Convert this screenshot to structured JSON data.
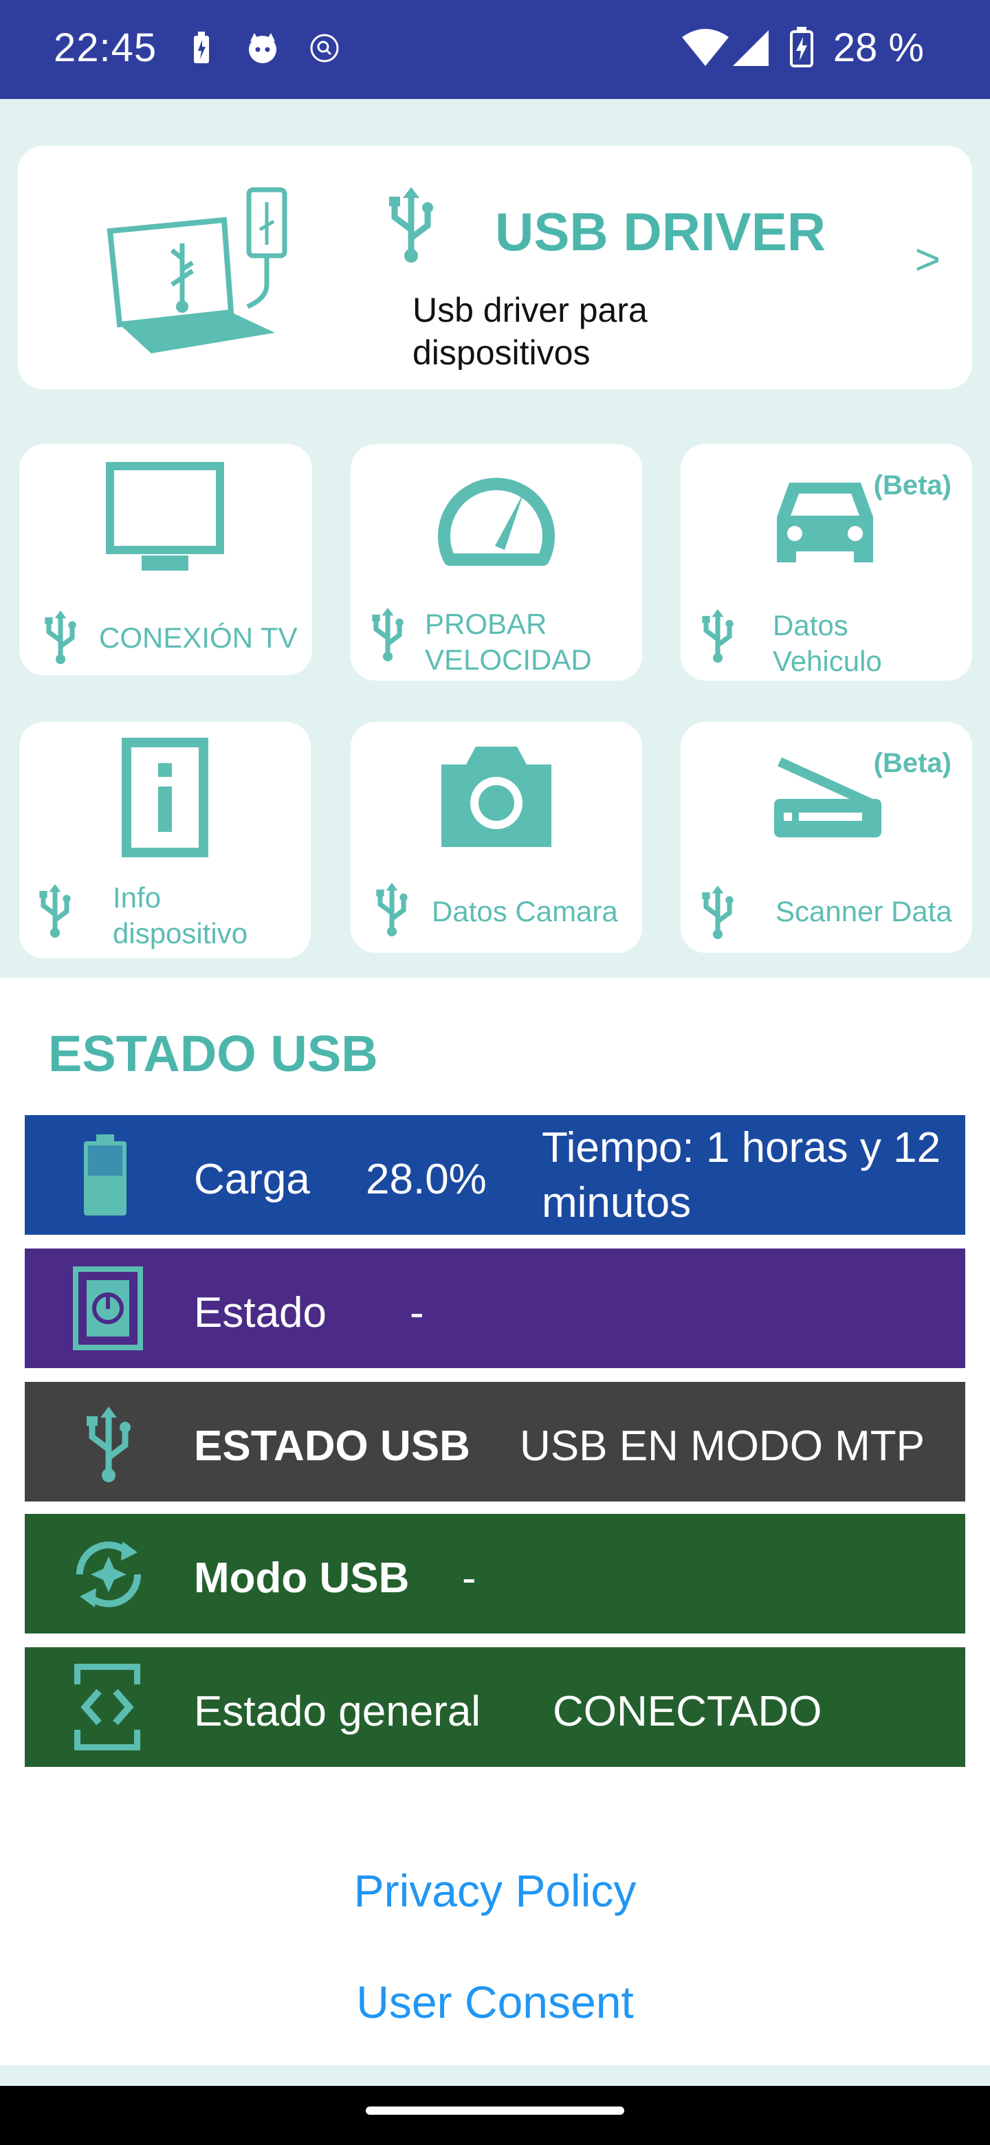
{
  "status_bar": {
    "time": "22:45",
    "battery_percent": "28 %",
    "icons": [
      "battery-saver-icon",
      "cat-notification-icon",
      "location-icon",
      "wifi-icon",
      "signal-icon",
      "battery-charging-icon"
    ]
  },
  "banner": {
    "title": "USB DRIVER",
    "description": "Usb driver para dispositivos Android.",
    "arrow": ">"
  },
  "tiles": [
    {
      "label": "CONEXIÓN TV",
      "icon": "tv-icon",
      "beta": ""
    },
    {
      "label": "PROBAR VELOCIDAD",
      "icon": "speedometer-icon",
      "beta": ""
    },
    {
      "label": "Datos Vehiculo",
      "icon": "car-icon",
      "beta": "(Beta)"
    },
    {
      "label": "Info dispositivo",
      "icon": "info-icon",
      "beta": ""
    },
    {
      "label": "Datos Camara",
      "icon": "camera-icon",
      "beta": ""
    },
    {
      "label": "Scanner Data",
      "icon": "scanner-icon",
      "beta": "(Beta)"
    }
  ],
  "estado": {
    "title": "ESTADO USB",
    "rows": [
      {
        "label": "Carga",
        "value": "28.0%",
        "extra": "Tiempo: 1 horas y 12 minutos",
        "color": "#1a49a0",
        "icon": "battery-icon"
      },
      {
        "label": "Estado",
        "value": "-",
        "color": "#4b2b87",
        "icon": "power-status-icon"
      },
      {
        "label": "ESTADO USB",
        "value": "USB EN MODO MTP",
        "color": "#424242",
        "icon": "usb-icon"
      },
      {
        "label": "Modo USB",
        "value": "-",
        "color": "#24602e",
        "icon": "sync-star-icon"
      },
      {
        "label": "Estado general",
        "value": "CONECTADO",
        "color": "#24602e",
        "icon": "connection-icon"
      }
    ]
  },
  "links": {
    "privacy": "Privacy Policy",
    "consent": "User Consent"
  },
  "colors": {
    "status_bar": "#2f3e9e",
    "accent": "#4db6ac",
    "background_top": "#e1f2f1",
    "link": "#2196f3"
  }
}
